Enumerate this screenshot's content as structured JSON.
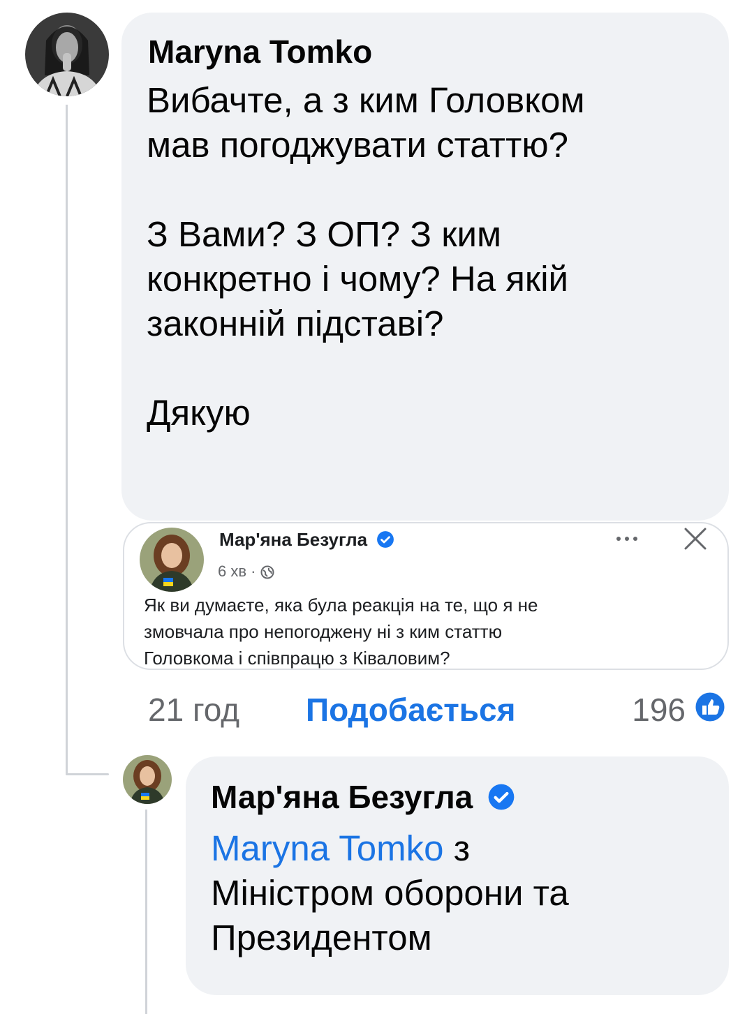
{
  "comment1": {
    "author": "Maryna Tomko",
    "text": "Вибачте, а з ким Головком\nмав погоджувати статтю?\n\nЗ Вами? З ОП? З ким\nконкретно і чому? На якій\nзаконній підставі?\n\nДякую",
    "time": "21 год",
    "like_label": "Подобається",
    "reaction_count": "196",
    "reaction_icon": "like-icon"
  },
  "shared_post": {
    "author": "Мар'яна Безугла",
    "meta": "6 хв · ",
    "text": "Як ви думаєте, яка була реакція на те, що я не\nзмовчала про непогоджену ні з ким статтю\nГоловкома і співпрацю з Ківаловим?",
    "more_icon": "more-dots-icon",
    "close_icon": "close-icon",
    "audience_icon": "globe-icon"
  },
  "reply1": {
    "author": "Мар'яна Безугла",
    "mention": "Maryna Tomko",
    "text": " з\nМіністром оборони та\nПрезидентом"
  },
  "colors": {
    "bubble_bg": "#f0f2f5",
    "link_blue": "#1b74e4",
    "secondary_text": "#65676b"
  }
}
